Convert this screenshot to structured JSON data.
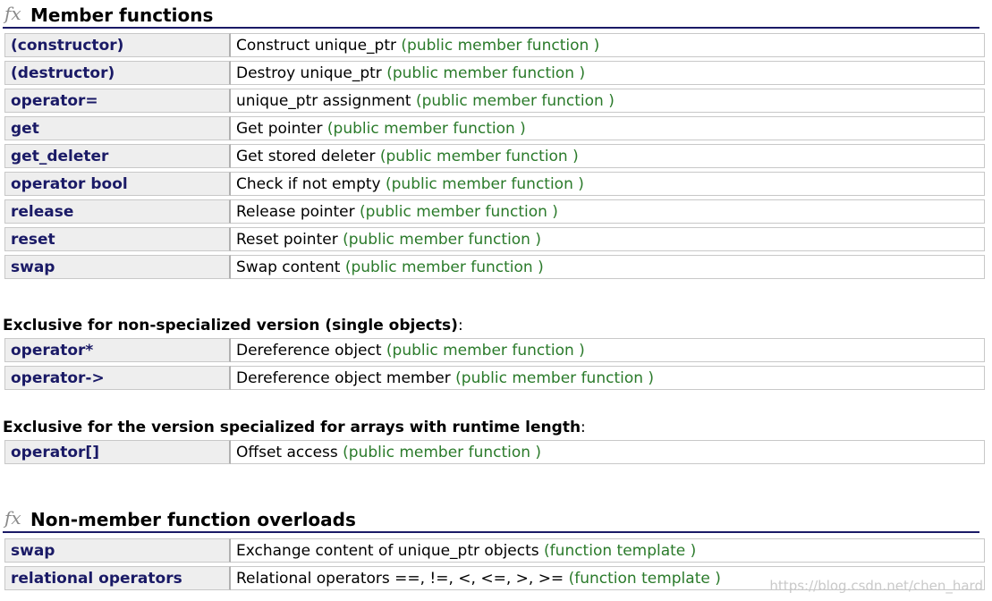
{
  "sections": [
    {
      "title": "Member functions",
      "icon": "fx-function-icon",
      "groups": [
        {
          "heading": "",
          "rows": [
            {
              "name": "(constructor)",
              "desc": "Construct unique_ptr",
              "kind": "(public member function )"
            },
            {
              "name": "(destructor)",
              "desc": "Destroy unique_ptr",
              "kind": "(public member function )"
            },
            {
              "name": "operator=",
              "desc": "unique_ptr assignment",
              "kind": "(public member function )"
            },
            {
              "name": "get",
              "desc": "Get pointer",
              "kind": "(public member function )"
            },
            {
              "name": "get_deleter",
              "desc": "Get stored deleter",
              "kind": "(public member function )"
            },
            {
              "name": "operator bool",
              "desc": "Check if not empty",
              "kind": "(public member function )"
            },
            {
              "name": "release",
              "desc": "Release pointer",
              "kind": "(public member function )"
            },
            {
              "name": "reset",
              "desc": "Reset pointer",
              "kind": "(public member function )"
            },
            {
              "name": "swap",
              "desc": "Swap content",
              "kind": "(public member function )"
            }
          ]
        },
        {
          "heading": "Exclusive for non-specialized version (single objects)",
          "rows": [
            {
              "name": "operator*",
              "desc": "Dereference object",
              "kind": "(public member function )"
            },
            {
              "name": "operator->",
              "desc": "Dereference object member",
              "kind": "(public member function )"
            }
          ]
        },
        {
          "heading": "Exclusive for the version specialized for arrays with runtime length",
          "rows": [
            {
              "name": "operator[]",
              "desc": "Offset access",
              "kind": "(public member function )"
            }
          ]
        }
      ]
    },
    {
      "title": "Non-member function overloads",
      "icon": "fx-function-icon",
      "groups": [
        {
          "heading": "",
          "rows": [
            {
              "name": "swap",
              "desc": "Exchange content of unique_ptr objects",
              "kind": "(function template )"
            },
            {
              "name": "relational operators",
              "desc": "Relational operators ==, !=, <, <=, >, >=",
              "kind": "(function template )"
            }
          ]
        }
      ]
    }
  ],
  "fx_glyph": "fx",
  "colon": ":",
  "watermark": "https://blog.csdn.net/chen_hard",
  "colors": {
    "name_link": "#1a1a66",
    "kind_text": "#2a7a2a",
    "name_cell_bg": "#eeeeee",
    "rule": "#1a1a66"
  }
}
